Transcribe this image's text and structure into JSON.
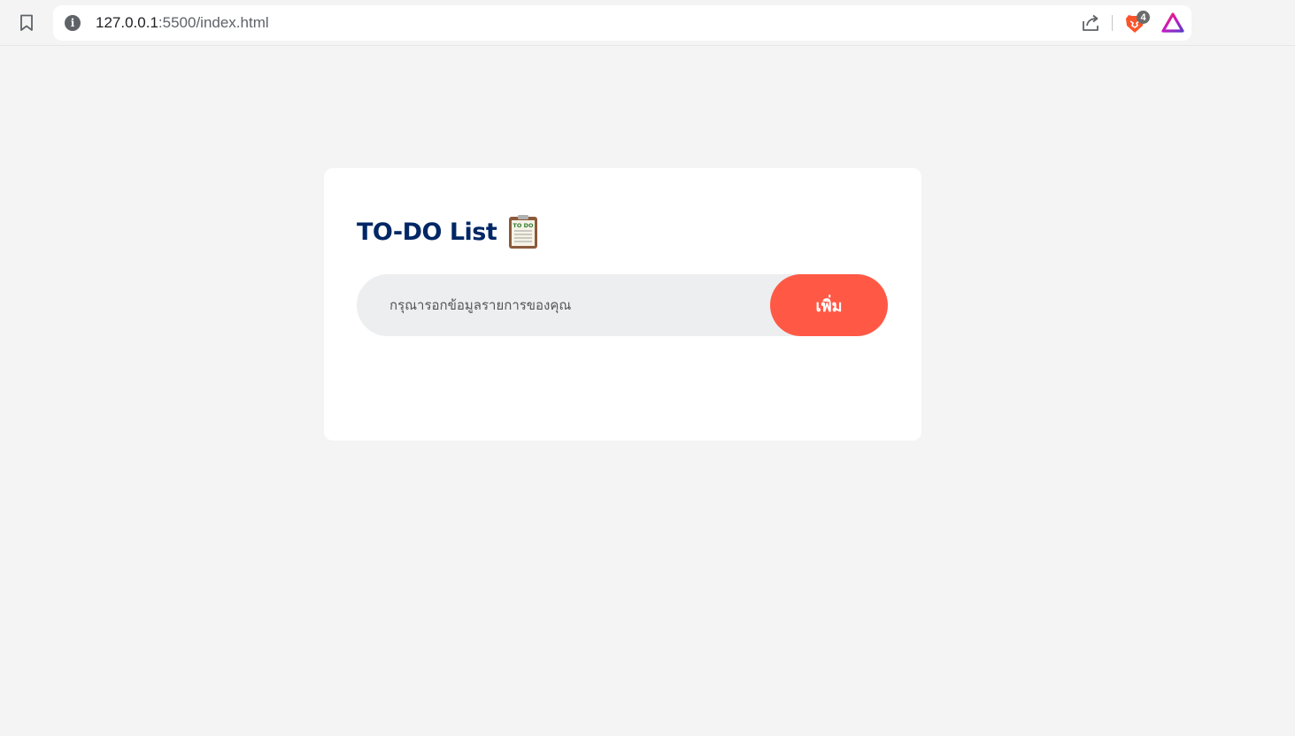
{
  "browser": {
    "url_host": "127.0.0.1",
    "url_path": ":5500/index.html",
    "brave_badge_count": "4"
  },
  "app": {
    "title": "TO-DO List",
    "clipboard_icon_text": "TO DO",
    "input": {
      "placeholder": "กรุณารอกข้อมูลรายการของคุณ",
      "value": ""
    },
    "add_button_label": "เพิ่ม",
    "items": []
  },
  "colors": {
    "title": "#002765",
    "accent": "#ff5945",
    "input_bg": "#edeef0",
    "page_bg": "#f4f4f4",
    "card_bg": "#ffffff"
  }
}
